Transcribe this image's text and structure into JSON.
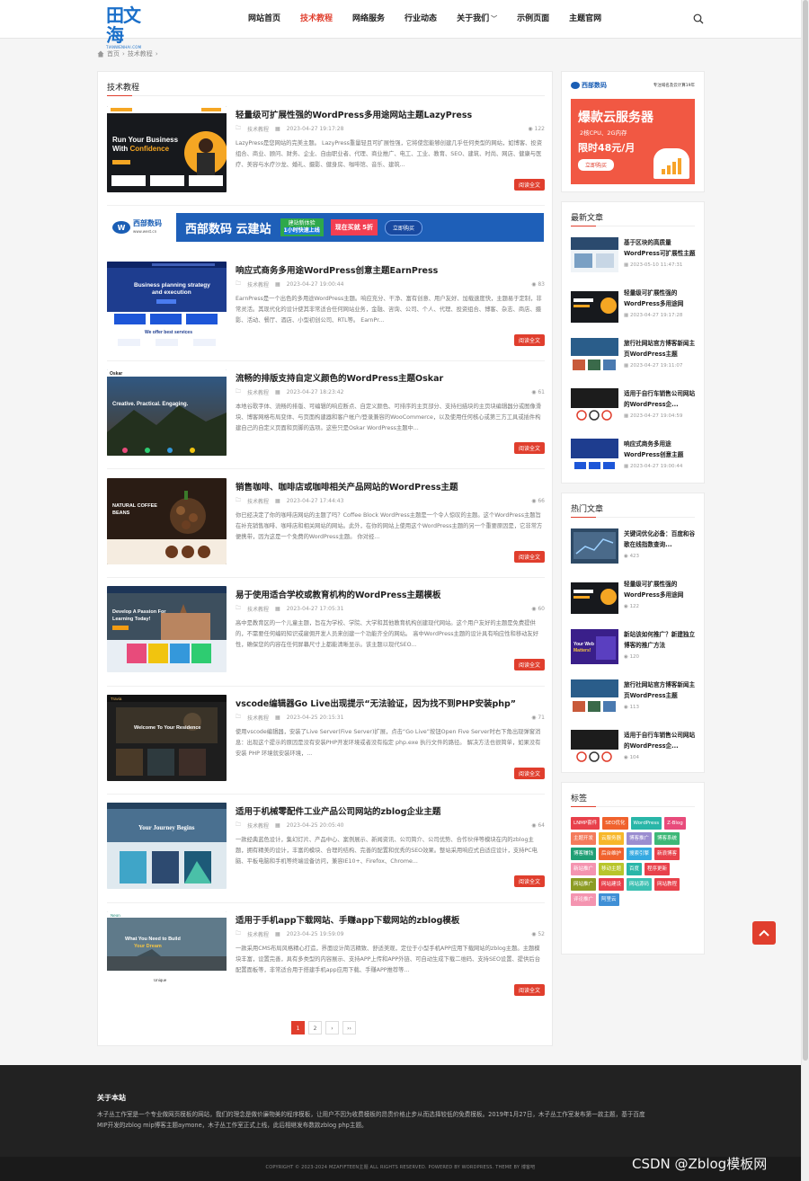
{
  "header": {
    "logo_cn": "田文海",
    "logo_en": "TIANWENHAI.COM",
    "nav": [
      {
        "label": "网站首页",
        "active": false
      },
      {
        "label": "技术教程",
        "active": true
      },
      {
        "label": "网络服务",
        "active": false
      },
      {
        "label": "行业动态",
        "active": false
      },
      {
        "label": "关于我们",
        "active": false,
        "dropdown": true
      },
      {
        "label": "示例页面",
        "active": false
      },
      {
        "label": "主题官网",
        "active": false
      }
    ]
  },
  "breadcrumb": {
    "home": "首页",
    "current": "技术教程"
  },
  "main": {
    "section_title": "技术教程",
    "read_more": "阅读全文",
    "posts": [
      {
        "title": "轻量级可扩展性强的WordPress多用途网站主题LazyPress",
        "category": "技术教程",
        "date": "2023-04-27 19:17:28",
        "views": "122",
        "excerpt": "LazyPress是您网站的完美主题。 LazyPress重量轻且可扩展性强，它将使您能够创建几乎任何类型的网站，如博客、投资组合、商业、顾问、财务、企业、自由职业者、代理、商业推广、电工、工业、教育、SEO、建筑、时尚、网店、健康与医疗、美容与水疗沙龙、婚礼、摄影、健身房、咖啡馆、音乐、建筑..."
      },
      {
        "title": "响应式商务多用途WordPress创意主题EarnPress",
        "category": "技术教程",
        "date": "2023-04-27 19:00:44",
        "views": "83",
        "excerpt": "EarnPress是一个出色的多用途WordPress主题。响应充分、干净、富有创意、用户友好、加载速度快，主题易于定制，非常灵活。其现代化的设计使其非常适合任何网站业务，金融、咨询、公司、个人、代理、投资组合、博客、杂志、商店、摄影、活动、餐厅、酒店、小型初创公司、RTL等。 EarnPr..."
      },
      {
        "title": "流畅的排版支持自定义颜色的WordPress主题Oskar",
        "category": "技术教程",
        "date": "2023-04-27 18:23:42",
        "views": "61",
        "excerpt": "本地谷歌字体、流畅的排版、可编辑的响应断点、自定义颜色、可排序的主页部分、支持扫描块的主页块编辑器分或图像滑块、博客网格布局变体、与页面构建器和客户帐户/登录兼容的WooCommerce，以及使用任何核心或第三方工具或插件构建自己的自定义页面和页脚的选项。这些只是Oskar WordPress主题中..."
      },
      {
        "title": "销售咖啡、咖啡店或咖啡相关产品网站的WordPress主题",
        "category": "技术教程",
        "date": "2023-04-27 17:44:43",
        "views": "66",
        "excerpt": "你已经决定了你的咖啡店网站的主题了吗？Coffee Block WordPress主题是一个令人惊叹的主题。这个WordPress主题旨在补充销售咖啡、咖啡店和相关网站的网站。此外，在你的网站上使用这个WordPress主题的另一个重要原因是，它非常方便携带，因为这是一个免费的WordPress主题。 你对经..."
      },
      {
        "title": "易于使用适合学校或教育机构的WordPress主题模板",
        "category": "技术教程",
        "date": "2023-04-27 17:05:31",
        "views": "60",
        "excerpt": "高中是教育区的一个儿童主题，旨在为学校、学院、大学和其他教育机构创建现代网站。这个用户友好的主题是免费提供的，不需要任何编码知识或雇佣开发人员来创建一个功能齐全的网站。 高中WordPress主题的设计具有响应性和移动友好性，确保您的内容在任何屏幕尺寸上都能清晰显示。该主题以现代SEO..."
      },
      {
        "title": "vscode编辑器Go Live出现提示“无法验证，因为找不到PHP安装php”",
        "category": "技术教程",
        "date": "2023-04-25 20:15:31",
        "views": "71",
        "excerpt": "使用vscode编辑器，安装了Live Server(Five Server)扩展，点击“Go Live”按钮Open Five Server时右下角出现弹窗消息：出现这个提示的原因是没有安装PHP开发环境或者没有指定 php.exe 执行文件的路径。 解决方法也很简单，如果没有安装 PHP 环境就安装环境，..."
      },
      {
        "title": "适用于机械零配件工业产品公司网站的zblog企业主题",
        "category": "技术教程",
        "date": "2023-04-25 20:05:40",
        "views": "64",
        "excerpt": "一款经典蓝色设计，集幻灯片、产品中心、案例展示、新闻资讯、公司简介、公司优势、合作伙伴等模块在内的zblog主题，拥有精美的设计，丰富的模块、合理的结构、完善的配置和优秀的SEO效果。整站采用响应式自适应设计，支持PC电脑、平板电脑和手机等终端设备访问，兼容IE10+、Firefox、Chrome..."
      },
      {
        "title": "适用于手机app下载网站、手赚app下载网站的zblog模板",
        "category": "技术教程",
        "date": "2023-04-25 19:59:09",
        "views": "52",
        "excerpt": "一款采用CMS布局风格精心打造，界面设计简洁精致、舒适美观，定位于小型手机APP应用下载网站的zblog主题。主题模块丰富，设置完善，具有多类型的内容展示、支持APP上传和APP外链、可自动生成下载二维码、支持SEO设置、提供后台配置面板等，非常适合用于搭建手机app应用下载、手赚APP推荐等..."
      }
    ],
    "banner": {
      "brand": "西部数码",
      "domain": "www.west.cn",
      "title": "西部数码 云建站",
      "box_line1": "建站新体验",
      "box_line2": "1小时快速上线",
      "offer": "现在买就 5折",
      "buy": "立即购买"
    },
    "pagination": [
      "1",
      "2",
      "›",
      "››"
    ]
  },
  "sidebar": {
    "ad": {
      "brand": "西部数码",
      "domain": "www.west.cn",
      "tagline": "专注域名及云计算19年",
      "title": "爆款云服务器",
      "spec": "2核CPU、2G内存",
      "price": "限时48元/月",
      "button": "立即购买"
    },
    "latest": {
      "title": "最新文章",
      "items": [
        {
          "title": "基于区块的高质量WordPress可扩展性主题C...",
          "date": "2023-05-10 11:47:31"
        },
        {
          "title": "轻量级可扩展性强的WordPress多用途网站...",
          "date": "2023-04-27 19:17:28"
        },
        {
          "title": "旅行社网站官方博客新闻主页WordPress主题",
          "date": "2023-04-27 19:11:07"
        },
        {
          "title": "适用于自行车销售公司网站的WordPress企...",
          "date": "2023-04-27 19:04:59"
        },
        {
          "title": "响应式商务多用途WordPress创意主题EarnP...",
          "date": "2023-04-27 19:00:44"
        }
      ]
    },
    "hot": {
      "title": "热门文章",
      "items": [
        {
          "title": "关键词优化必备：百度和谷歌在线指数查询...",
          "views": "423"
        },
        {
          "title": "轻量级可扩展性强的WordPress多用途网站...",
          "views": "122"
        },
        {
          "title": "新站该如何推广？新建独立博客的推广方法",
          "views": "120"
        },
        {
          "title": "旅行社网站官方博客新闻主页WordPress主题",
          "views": "113"
        },
        {
          "title": "适用于自行车销售公司网站的WordPress企...",
          "views": "104"
        }
      ]
    },
    "tags": {
      "title": "标签",
      "items": [
        {
          "label": "LNMP套件",
          "color": "#e8414b"
        },
        {
          "label": "SEO优化",
          "color": "#f0622d"
        },
        {
          "label": "WordPress",
          "color": "#29b6a8"
        },
        {
          "label": "Z-Blog",
          "color": "#e84b7b"
        },
        {
          "label": "主题开发",
          "color": "#f47b5c"
        },
        {
          "label": "云服务器",
          "color": "#f7b72a"
        },
        {
          "label": "博客推广",
          "color": "#9b8dd0"
        },
        {
          "label": "博客系统",
          "color": "#3db877"
        },
        {
          "label": "博客赚钱",
          "color": "#1f9f75"
        },
        {
          "label": "后台维护",
          "color": "#f0622d"
        },
        {
          "label": "搜索引擎",
          "color": "#35a9e1"
        },
        {
          "label": "新浪博客",
          "color": "#e8414b"
        },
        {
          "label": "新站推广",
          "color": "#f494b0"
        },
        {
          "label": "移动主题",
          "color": "#b8c52b"
        },
        {
          "label": "百度",
          "color": "#29b6a8"
        },
        {
          "label": "程序更新",
          "color": "#e8414b"
        },
        {
          "label": "网站推广",
          "color": "#8d9c24"
        },
        {
          "label": "网站建设",
          "color": "#e8414b"
        },
        {
          "label": "网站源码",
          "color": "#3cc0b2"
        },
        {
          "label": "网站教程",
          "color": "#e8414b"
        },
        {
          "label": "评论推广",
          "color": "#f494b0"
        },
        {
          "label": "阿里云",
          "color": "#3f8fd6"
        }
      ]
    }
  },
  "footer": {
    "about_title": "关于本站",
    "about_text": "木子丛工作室是一个专业做网页模板的网站，我们的理念是做价廉物美的程序模板，让用户不因为收费模板的昂贵价格止步从而选择较低的免费模板。2019年1月27日，木子丛工作室发布第一款主题，基于百度MIP开发的zblog mip博客主题aymone，木子丛工作室正式上线，此后相继发布数款zblog php主题。",
    "copyright": "COPYRIGHT © 2023-2024 MZAFIFTEEN主题 ALL RIGHTS RESERVED. POWERED BY WORDPRESS. THEME BY 博客吧",
    "watermark": "CSDN @Zblog模板网"
  }
}
